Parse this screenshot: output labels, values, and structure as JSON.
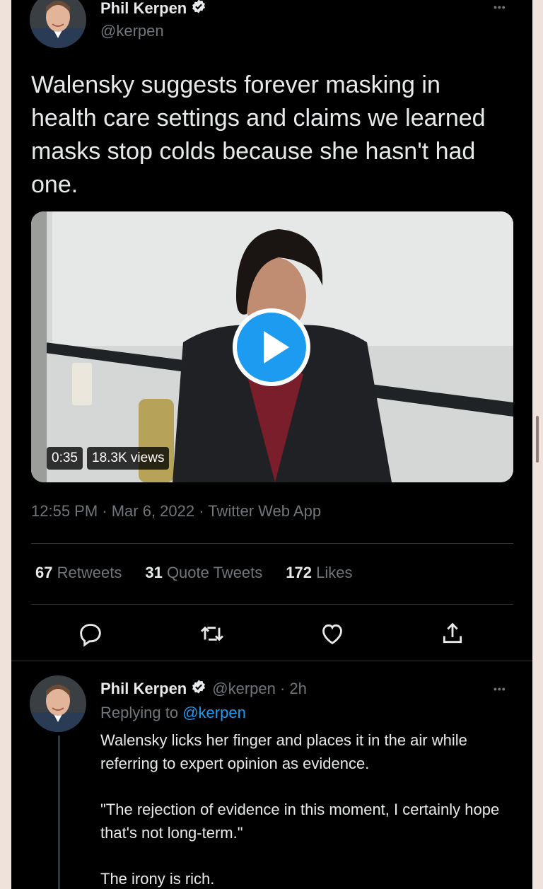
{
  "tweet": {
    "author_name": "Phil Kerpen",
    "author_handle": "@kerpen",
    "more_label": "•••",
    "text": "Walensky suggests forever masking in health care settings and claims we learned masks stop colds because she hasn't had one.",
    "video": {
      "duration": "0:35",
      "views": "18.3K views"
    },
    "meta": "12:55 PM · Mar 6, 2022 · Twitter Web App",
    "stats": {
      "retweets_count": "67",
      "retweets_label": "Retweets",
      "quotes_count": "31",
      "quotes_label": "Quote Tweets",
      "likes_count": "172",
      "likes_label": "Likes"
    },
    "actions": [
      "reply-icon",
      "retweet-icon",
      "like-icon",
      "share-icon"
    ]
  },
  "reply": {
    "author_name": "Phil Kerpen",
    "author_handle_time": "@kerpen · 2h",
    "more_label": "•••",
    "replying_prefix": "Replying to",
    "replying_handle": "@kerpen",
    "paragraph1": "Walensky licks her finger and places it in the air while referring to expert opinion as evidence.",
    "paragraph2": "\"The rejection of evidence in this moment, I certainly hope that's not long-term.\"",
    "paragraph3": "The irony is rich."
  },
  "colors": {
    "background": "#000000",
    "text": "#e7e9ea",
    "secondary": "#71767b",
    "accent": "#1d9bf0",
    "outer_frame": "#efe2da"
  }
}
